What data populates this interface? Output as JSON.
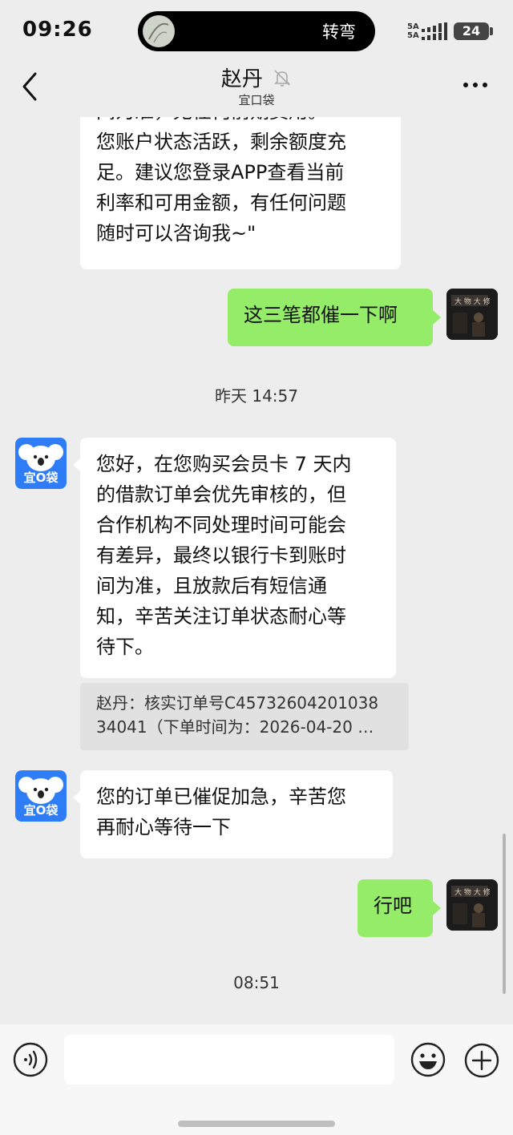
{
  "status_bar": {
    "time": "09:26",
    "island_text": "转弯",
    "network_label_1": "5A",
    "network_label_2": "5A",
    "battery": "24"
  },
  "header": {
    "title": "赵丹",
    "subtitle": "宜口袋",
    "back_icon": "chevron-left-icon",
    "mute_icon": "bell-off-icon",
    "more_icon": "more-horizontal-icon"
  },
  "messages": [
    {
      "side": "left",
      "text": "间为准，无任何前期费用。\n您账户状态活跃，剩余额度充\n足。建议您登录APP查看当前\n利率和可用金额，有任何问题\n随时可以咨询我~\""
    },
    {
      "side": "right",
      "text": "这三笔都催一下啊"
    },
    {
      "timestamp": "昨天 14:57"
    },
    {
      "side": "left",
      "avatar_label": "宜O袋",
      "text": "您好，在您购买会员卡 7 天内\n的借款订单会优先审核的，但\n合作机构不同处理时间可能会\n有差异，最终以银行卡到账时\n间为准，且放款后有短信通\n知，辛苦关注订单状态耐心等\n待下。"
    },
    {
      "quote_line_1": "赵丹：核实订单号C45732604201038",
      "quote_line_2": "34041（下单时间为：2026-04-20 …"
    },
    {
      "side": "left",
      "avatar_label": "宜O袋",
      "text": "您的订单已催促加急，辛苦您\n再耐心等待一下"
    },
    {
      "side": "right",
      "text": "行吧"
    },
    {
      "timestamp": "08:51"
    }
  ],
  "input_bar": {
    "voice_icon": "voice-icon",
    "emoji_icon": "emoji-icon",
    "plus_icon": "plus-circle-icon",
    "input_value": ""
  },
  "colors": {
    "background": "#ededed",
    "sent_bubble": "#95ec69",
    "received_bubble": "#ffffff",
    "app_avatar": "#2f7df6"
  }
}
